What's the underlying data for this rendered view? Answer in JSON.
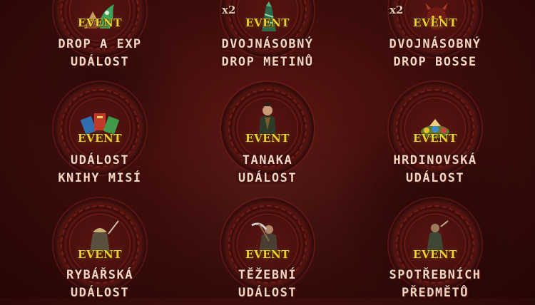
{
  "badge_text": "EVENT",
  "colors": {
    "background": "#3d0d0b",
    "event_text": "#f0cf2c",
    "title_text": "#f1d6c2"
  },
  "events": [
    {
      "line1": "DROP A EXP",
      "line2": "UDÁLOST",
      "multiplier": "",
      "icon": "dragon-and-book-icon"
    },
    {
      "line1": "DVOJNÁSOBNÝ",
      "line2": "DROP METINŮ",
      "multiplier": "x2",
      "icon": "metin-stone-icon"
    },
    {
      "line1": "DVOJNÁSOBNÝ",
      "line2": "DROP BOSSE",
      "multiplier": "x2",
      "icon": "boss-demon-icon"
    },
    {
      "line1": "UDÁLOST",
      "line2": "KNIHY MISÍ",
      "multiplier": "",
      "icon": "mission-books-icon"
    },
    {
      "line1": "TANAKA",
      "line2": "UDÁLOST",
      "multiplier": "",
      "icon": "tanaka-warrior-icon"
    },
    {
      "line1": "HRDINOVSKÁ",
      "line2": "UDÁLOST",
      "multiplier": "",
      "icon": "hero-treasure-icon"
    },
    {
      "line1": "RYBÁŘSKÁ",
      "line2": "UDÁLOST",
      "multiplier": "",
      "icon": "fisherman-icon"
    },
    {
      "line1": "TĚŽEBNÍ",
      "line2": "UDÁLOST",
      "multiplier": "",
      "icon": "miner-pickaxe-icon"
    },
    {
      "line1": "SPOTŘEBNÍCH",
      "line2": "PŘEDMĚTŮ",
      "multiplier": "",
      "icon": "consumables-figure-icon"
    }
  ]
}
